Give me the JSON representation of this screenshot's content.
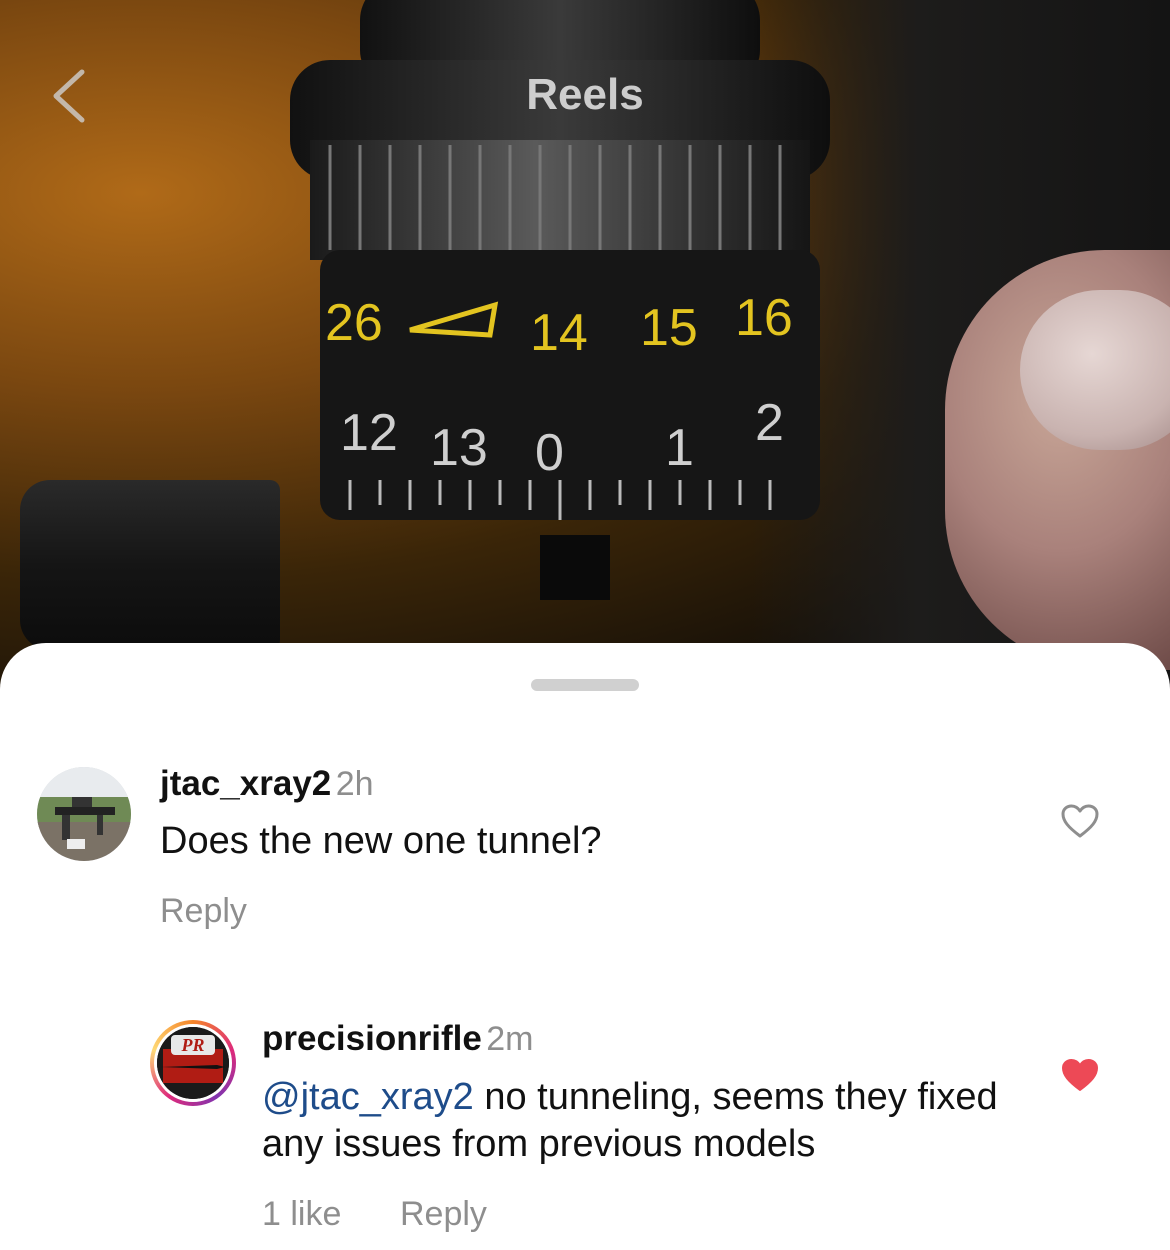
{
  "header": {
    "title": "Reels",
    "back_icon": "chevron-left-icon"
  },
  "video": {
    "description_icon": "scope-turret-video-frame"
  },
  "comments": [
    {
      "username": "jtac_xray2",
      "time": "2h",
      "text": "Does the new one tunnel?",
      "reply_label": "Reply",
      "liked": false,
      "like_icon": "heart-outline-icon"
    },
    {
      "username": "precisionrifle",
      "time": "2m",
      "mention": "@jtac_xray2",
      "text": " no tunneling, seems they fixed any issues from previous models",
      "likes_label": "1 like",
      "reply_label": "Reply",
      "liked": true,
      "like_icon": "heart-filled-icon",
      "avatar_text": "PR"
    }
  ],
  "colors": {
    "like_red": "#ed4956",
    "mention_blue": "#1e4c8a",
    "secondary_text": "#8e8e8e"
  }
}
